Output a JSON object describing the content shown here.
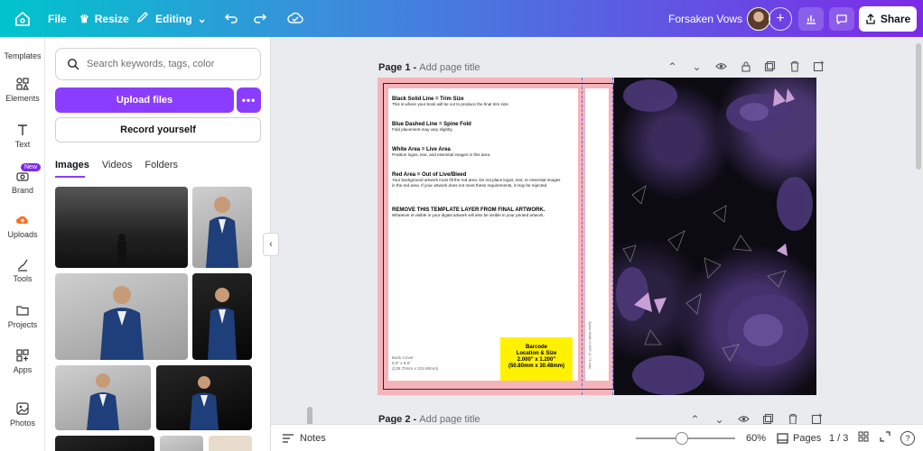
{
  "topbar": {
    "file": "File",
    "resize": "Resize",
    "editing": "Editing",
    "doc_title": "Forsaken Vows",
    "share": "Share"
  },
  "rail": [
    {
      "label": "Templates",
      "icon": "templates-icon"
    },
    {
      "label": "Elements",
      "icon": "elements-icon"
    },
    {
      "label": "Text",
      "icon": "text-icon"
    },
    {
      "label": "Brand",
      "icon": "brand-icon",
      "badge": "New"
    },
    {
      "label": "Uploads",
      "icon": "uploads-icon"
    },
    {
      "label": "Tools",
      "icon": "tools-icon"
    },
    {
      "label": "Projects",
      "icon": "projects-icon"
    },
    {
      "label": "Apps",
      "icon": "apps-icon"
    },
    {
      "label": "Photos",
      "icon": "photos-icon"
    }
  ],
  "panel": {
    "search_placeholder": "Search keywords, tags, color",
    "upload_files": "Upload files",
    "more": "•••",
    "record": "Record yourself",
    "tabs": [
      "Images",
      "Videos",
      "Folders"
    ]
  },
  "page1": {
    "label": "Page 1 - ",
    "title_placeholder": "Add page title"
  },
  "page2": {
    "label": "Page 2 - ",
    "title_placeholder": "Add page title"
  },
  "template": {
    "notes": [
      {
        "h": "Black Solid Line = Trim Size",
        "b": "This is where your book will be cut to produce the final trim size."
      },
      {
        "h": "Blue Dashed Line = Spine Fold",
        "b": "Fold placement may vary slightly."
      },
      {
        "h": "White Area = Live Area",
        "b": "Position logos, text, and essential images in this area."
      },
      {
        "h": "Red Area = Out of Live/Bleed",
        "b": "Your background artwork must fill the red area. Do not place logos, text, or essential images in the red area. If your artwork does not meet these requirements, it may be rejected."
      },
      {
        "h": "REMOVE THIS TEMPLATE LAYER FROM FINAL ARTWORK.",
        "b": "Whatever is visible in your digital artwork will also be visible in your printed artwork."
      }
    ],
    "back_cover": [
      "Back Cover",
      "5.5\" x 8.5\"",
      "(139.70mm x 215.90mm)"
    ],
    "barcode": [
      "Barcode",
      "Location & Size",
      "2.000\" x 1.200\"",
      "(50.80mm x 30.48mm)"
    ],
    "spine_text": "Spine Width 0.069\" (1.74 mm)"
  },
  "bottom": {
    "notes": "Notes",
    "zoom": "60%",
    "pages": "Pages",
    "page_count": "1 / 3",
    "help": "?"
  },
  "colors": {
    "accent": "#8b3dff",
    "bleed": "#f5b3ba",
    "barcode": "#fff200"
  }
}
